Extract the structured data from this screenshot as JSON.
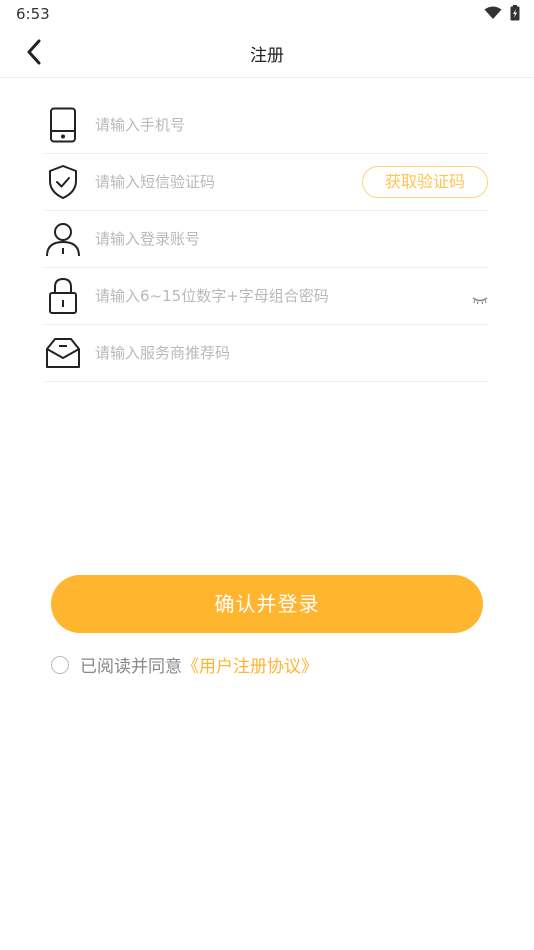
{
  "status_bar": {
    "time": "6:53",
    "icons": [
      "wifi-icon",
      "battery-charging-icon"
    ]
  },
  "nav": {
    "title": "注册",
    "back_icon": "chevron-left-icon"
  },
  "form": {
    "phone": {
      "placeholder": "请输入手机号",
      "icon": "phone-icon"
    },
    "code": {
      "placeholder": "请输入短信验证码",
      "icon": "shield-check-icon",
      "button_label": "获取验证码"
    },
    "account": {
      "placeholder": "请输入登录账号",
      "icon": "user-icon"
    },
    "password": {
      "placeholder": "请输入6~15位数字+字母组合密码",
      "icon": "lock-icon",
      "toggle_icon": "eye-closed-icon"
    },
    "referral": {
      "placeholder": "请输入服务商推荐码",
      "icon": "envelope-icon"
    }
  },
  "submit": {
    "label": "确认并登录"
  },
  "agreement": {
    "text": "已阅读并同意",
    "link": "《用户注册协议》"
  },
  "colors": {
    "accent": "#ffb52e",
    "code_button": "#ffc451",
    "placeholder": "#b9b9b9"
  }
}
